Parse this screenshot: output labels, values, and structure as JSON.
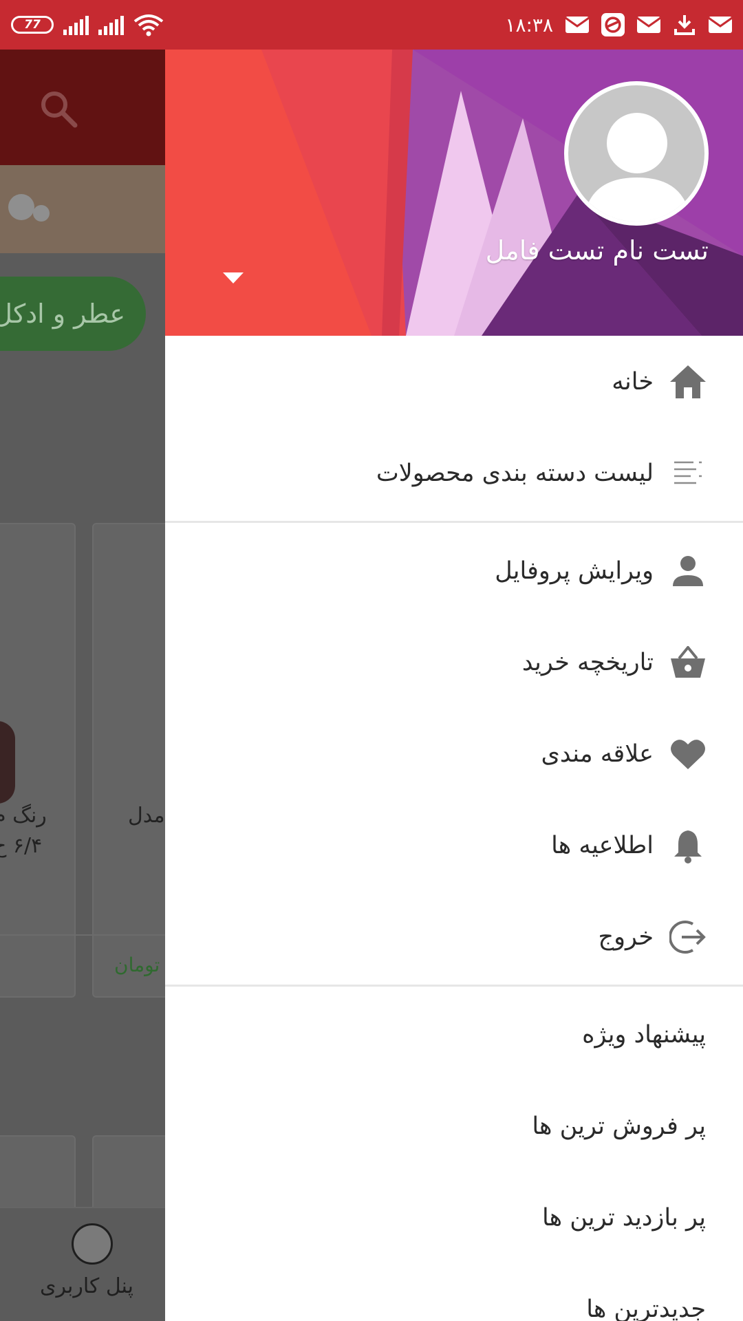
{
  "status_bar": {
    "time": "۱۸:۳۸",
    "battery": "77"
  },
  "background": {
    "chip_label": "عطر و ادکل",
    "card1_text1": "رنگ م",
    "card1_text2": "۶/۴ ح",
    "card2_text": "مدل",
    "price_unit": "تومان",
    "bottom_nav_label": "پنل کاربری"
  },
  "drawer": {
    "user_name": "تست نام تست فامل",
    "items_group1": [
      {
        "label": "خانه",
        "icon": "home-icon"
      },
      {
        "label": "لیست دسته بندی محصولات",
        "icon": "list-icon"
      }
    ],
    "items_group2": [
      {
        "label": "ویرایش پروفایل",
        "icon": "person-icon"
      },
      {
        "label": "تاریخچه خرید",
        "icon": "basket-icon"
      },
      {
        "label": "علاقه مندی",
        "icon": "heart-icon"
      },
      {
        "label": "اطلاعیه ها",
        "icon": "bell-icon"
      },
      {
        "label": "خروج",
        "icon": "logout-icon"
      }
    ],
    "items_group3": [
      {
        "label": "پیشنهاد ویژه"
      },
      {
        "label": "پر فروش ترین ها"
      },
      {
        "label": "پر بازدید ترین ها"
      },
      {
        "label": "جدیدترین ها"
      }
    ]
  },
  "colors": {
    "status_bar": "#c62a31",
    "icon_gray": "#6f6f6f",
    "text": "#2a2a2a"
  }
}
